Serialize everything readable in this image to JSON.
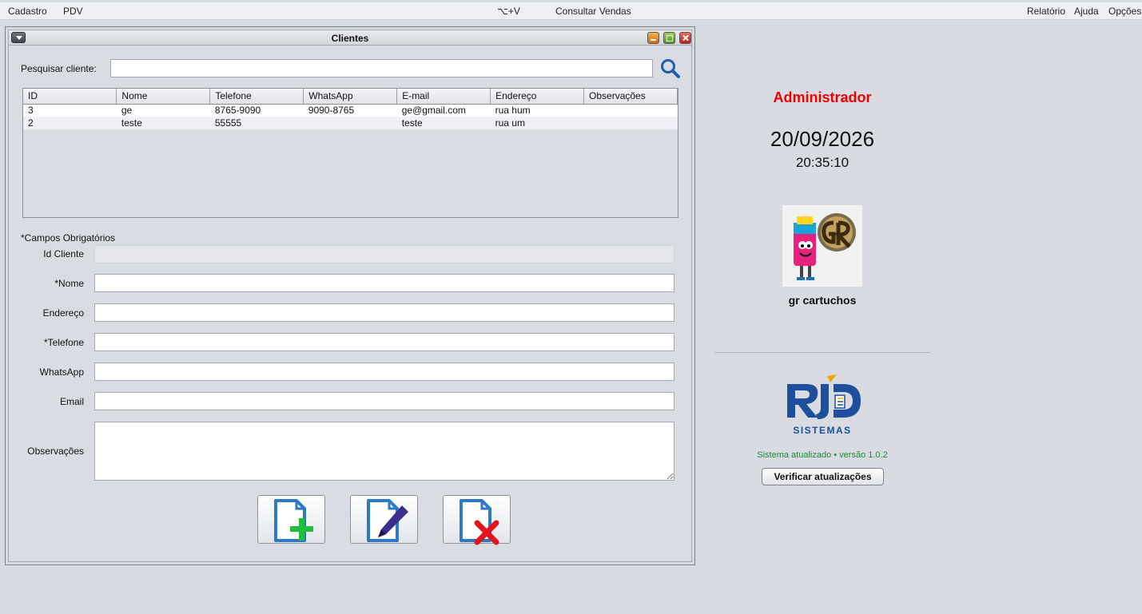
{
  "menubar": {
    "cadastro": "Cadastro",
    "pdv": "PDV",
    "shortcut": "⌥+V",
    "consultar_vendas": "Consultar Vendas",
    "relatorio": "Relatório",
    "ajuda": "Ajuda",
    "opcoes": "Opções"
  },
  "window": {
    "title": "Clientes"
  },
  "search": {
    "label": "Pesquisar cliente:",
    "value": ""
  },
  "table": {
    "columns": [
      "ID",
      "Nome",
      "Telefone",
      "WhatsApp",
      "E-mail",
      "Endereço",
      "Observações"
    ],
    "rows": [
      [
        "3",
        "ge",
        "8765-9090",
        "9090-8765",
        "ge@gmail.com",
        "rua hum",
        ""
      ],
      [
        "2",
        "teste",
        "55555",
        "",
        "teste",
        "rua um",
        ""
      ]
    ]
  },
  "form": {
    "required_note": "*Campos Obrigatórios",
    "id_label": "Id Cliente",
    "nome_label": "*Nome",
    "endereco_label": "Endereço",
    "telefone_label": "*Telefone",
    "whatsapp_label": "WhatsApp",
    "email_label": "Email",
    "obs_label": "Observações"
  },
  "icons": {
    "add": "document-add-icon",
    "edit": "document-edit-icon",
    "delete": "document-delete-icon",
    "search": "search-icon"
  },
  "side": {
    "role": "Administrador",
    "date": "20/09/2026",
    "time": "20:35:10",
    "store_name": "gr cartuchos",
    "brand_logo_text": "SISTEMAS",
    "version_text": "Sistema atualizado • versão 1.0.2",
    "update_button": "Verificar atualizações"
  },
  "colors": {
    "role": "#ee0000",
    "version": "#1e8a3b",
    "brand_blue": "#1d4f9c",
    "brand_gold": "#f0a800"
  }
}
